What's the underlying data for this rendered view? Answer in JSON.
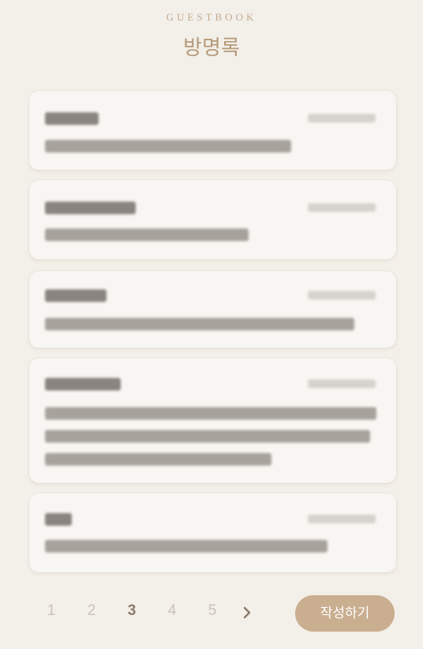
{
  "header": {
    "eyebrow": "GUESTBOOK",
    "title": "방명록"
  },
  "entries": [
    {
      "name": "",
      "date": "",
      "message_lines": [
        ""
      ]
    },
    {
      "name": "",
      "date": "",
      "message_lines": [
        ""
      ]
    },
    {
      "name": "",
      "date": "",
      "message_lines": [
        ""
      ]
    },
    {
      "name": "",
      "date": "",
      "message_lines": [
        "",
        "",
        ""
      ]
    },
    {
      "name": "",
      "date": "",
      "message_lines": [
        ""
      ]
    }
  ],
  "pagination": {
    "pages": [
      "1",
      "2",
      "3",
      "4",
      "5"
    ],
    "current_page": "3",
    "next_icon": "chevron-right-icon"
  },
  "write_button": {
    "label": "작성하기"
  },
  "colors": {
    "background": "#f3efe9",
    "accent": "#c9ae8f",
    "title": "#b59a79"
  }
}
